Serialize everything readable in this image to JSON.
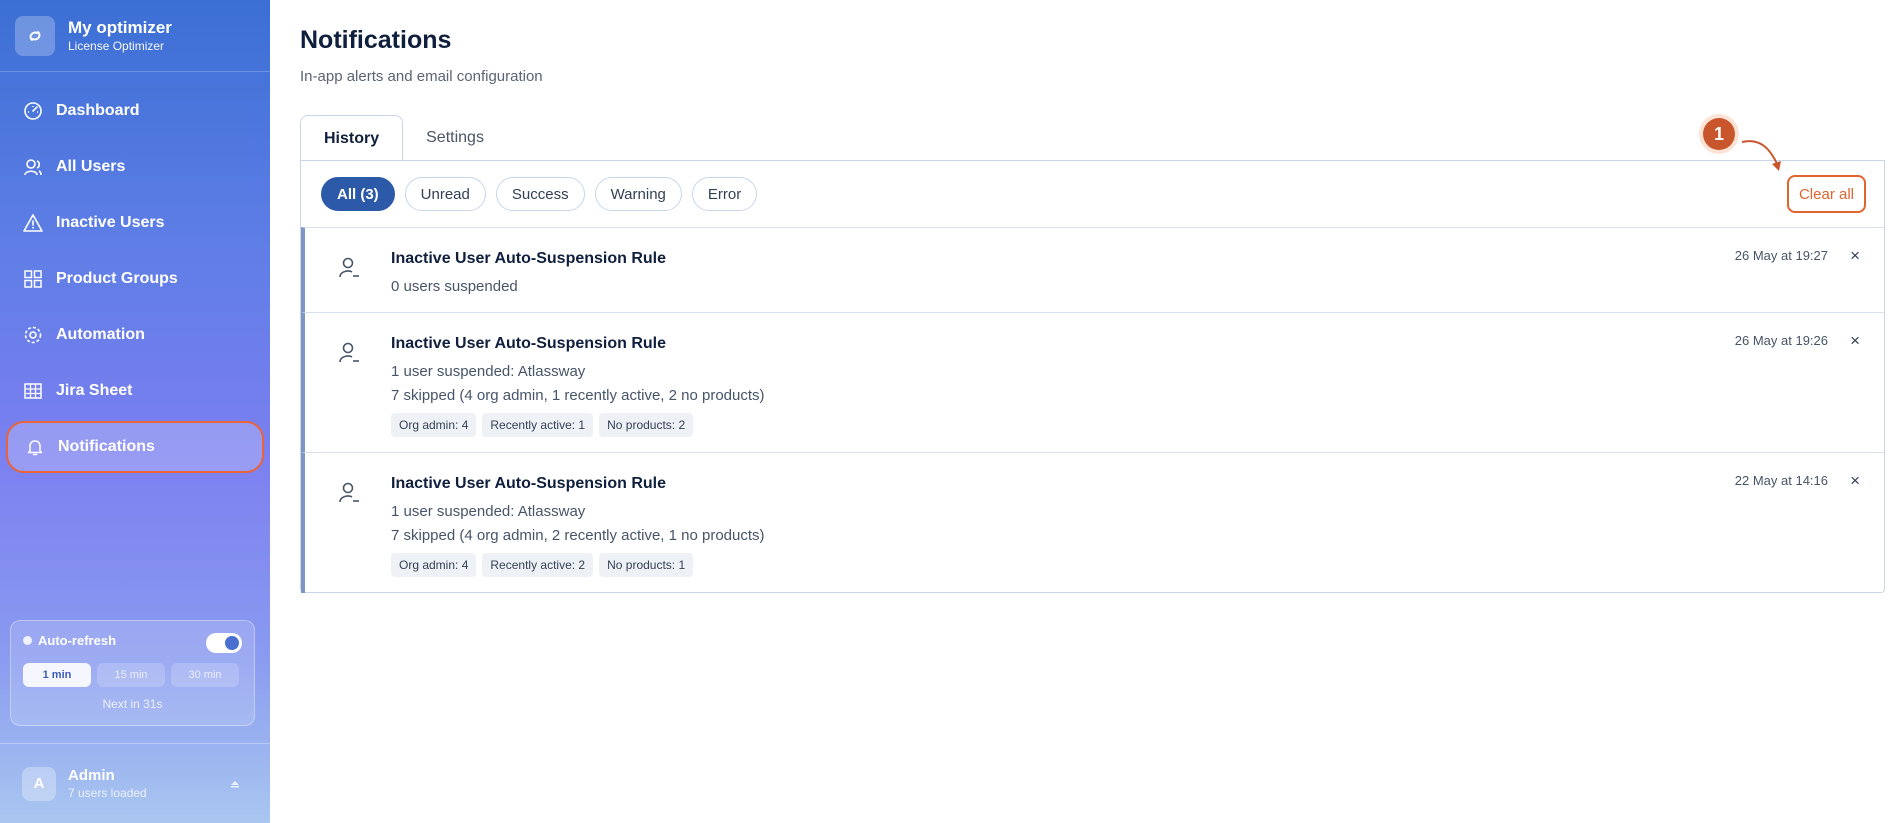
{
  "brand": {
    "title": "My optimizer",
    "subtitle": "License Optimizer"
  },
  "nav": [
    {
      "label": "Dashboard",
      "icon": "gauge-icon"
    },
    {
      "label": "All Users",
      "icon": "users-icon"
    },
    {
      "label": "Inactive Users",
      "icon": "warning-triangle-icon"
    },
    {
      "label": "Product Groups",
      "icon": "grid-icon"
    },
    {
      "label": "Automation",
      "icon": "gear-icon"
    },
    {
      "label": "Jira Sheet",
      "icon": "table-icon"
    },
    {
      "label": "Notifications",
      "icon": "bell-icon",
      "active": true
    }
  ],
  "refresh": {
    "label": "Auto-refresh",
    "enabled": true,
    "intervals": [
      "1 min",
      "15 min",
      "30 min"
    ],
    "selected": "1 min",
    "next": "Next in 31s"
  },
  "user": {
    "initial": "A",
    "name": "Admin",
    "sub": "7 users loaded"
  },
  "page": {
    "title": "Notifications",
    "subtitle": "In-app alerts and email configuration"
  },
  "tabs": [
    "History",
    "Settings"
  ],
  "filters": [
    "All (3)",
    "Unread",
    "Success",
    "Warning",
    "Error"
  ],
  "clear_all": "Clear all",
  "annotation": "1",
  "notifications": [
    {
      "title": "Inactive User Auto-Suspension Rule",
      "lines": [
        "0 users suspended"
      ],
      "tags": [],
      "time": "26 May at 19:27"
    },
    {
      "title": "Inactive User Auto-Suspension Rule",
      "lines": [
        "1 user suspended: Atlassway",
        "7 skipped (4 org admin, 1 recently active, 2 no products)"
      ],
      "tags": [
        "Org admin: 4",
        "Recently active: 1",
        "No products: 2"
      ],
      "time": "26 May at 19:26"
    },
    {
      "title": "Inactive User Auto-Suspension Rule",
      "lines": [
        "1 user suspended: Atlassway",
        "7 skipped (4 org admin, 2 recently active, 1 no products)"
      ],
      "tags": [
        "Org admin: 4",
        "Recently active: 2",
        "No products: 1"
      ],
      "time": "22 May at 14:16"
    }
  ],
  "close_symbol": "×",
  "colors": {
    "accent": "#2d5aa8",
    "highlight": "#e0642f"
  }
}
